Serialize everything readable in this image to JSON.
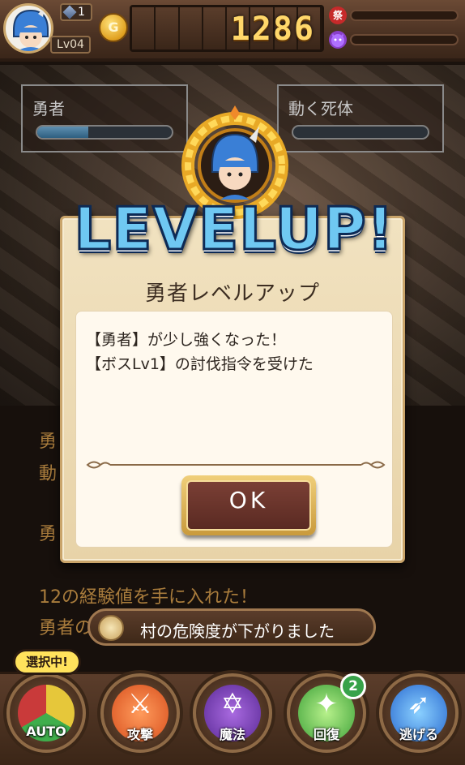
{
  "header": {
    "gem_count": "1",
    "level": "Lv04",
    "coin_icon_text": "G",
    "gold": "1286",
    "festival_icon_text": "祭",
    "festival_fill": 0.0,
    "demon_fill": 0.0
  },
  "battle": {
    "hero": {
      "name": "勇者",
      "hp_fill": 0.38
    },
    "enemy": {
      "name": "動く死体",
      "hp_fill": 0.0
    }
  },
  "levelup": {
    "title": "LEVELUP!",
    "dialog_title": "勇者レベルアップ",
    "messages": [
      "【勇者】が少し強くなった！",
      "【ボスLv1】の討伐指令を受けた"
    ],
    "ok_label": "OK"
  },
  "log": {
    "line_1": "勇",
    "line_2": "動",
    "line_3": "勇",
    "line_4": "12の経験値を手に入れた！",
    "line_5": "勇者の"
  },
  "toast": {
    "text": "村の危険度が下がりました"
  },
  "commands": {
    "selected_tag": "選択中!",
    "auto": "AUTO",
    "attack": "攻撃",
    "magic": "魔法",
    "heal": "回復",
    "heal_badge": "2",
    "escape": "逃げる"
  },
  "colors": {
    "bar_wood": "#4a3122",
    "levelup_blue": "#6fc8f2",
    "dialog_bg": "#f1e2c0",
    "log_text": "#a97c3c"
  }
}
